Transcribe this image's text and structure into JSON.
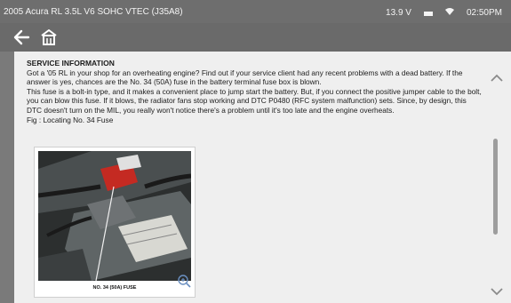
{
  "statusbar": {
    "vehicle_title": "2005 Acura RL 3.5L V6 SOHC VTEC (J35A8)",
    "voltage": "13.9 V",
    "time": "02:50PM",
    "battery_icon": "battery-icon",
    "wifi_icon": "wifi-icon"
  },
  "nav": {
    "back_icon": "back-arrow-icon",
    "home_icon": "home-icon"
  },
  "article": {
    "heading": "SERVICE INFORMATION",
    "paragraph1": "Got a '05 RL in your shop for an overheating engine? Find out if your service client had any recent problems with a dead battery. If the answer is yes, chances are the No. 34 (50A) fuse in the battery terminal fuse box is blown.",
    "paragraph2": "This fuse is a bolt-in type, and it makes a convenient place to jump start the battery. But, if you connect the positive jumper cable to the bolt, you can blow this fuse. If it blows, the radiator fans stop working and DTC P0480 (RFC system malfunction) sets. Since, by design, this DTC doesn't turn on the MIL, you really won't notice there's a problem until it's too late and the engine overheats.",
    "fig_label": "Fig : Locating No. 34 Fuse"
  },
  "figure": {
    "caption": "NO. 34 (50A) FUSE",
    "zoom_icon": "zoom-in-icon"
  },
  "scroll": {
    "up_icon": "chevron-up-icon",
    "down_icon": "chevron-down-icon"
  }
}
